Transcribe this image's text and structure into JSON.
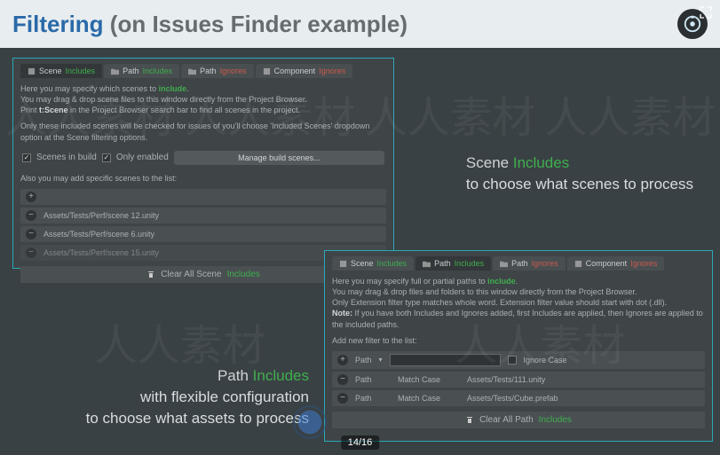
{
  "header": {
    "title_a": "Filtering",
    "title_b": "(on Issues Finder example)"
  },
  "pager": "14/16",
  "captions": {
    "scene_lead": "Scene ",
    "scene_inc": "Includes",
    "scene_sub": "to choose what scenes to process",
    "path_lead": "Path ",
    "path_inc": "Includes",
    "path_sub1": "with flexible configuration",
    "path_sub2": "to choose what assets to process"
  },
  "scene_panel": {
    "tabs": {
      "scene_includes": {
        "pre": "Scene ",
        "suf": "Includes"
      },
      "path_includes": {
        "pre": "Path ",
        "suf": "Includes"
      },
      "path_ignores": {
        "pre": "Path ",
        "suf": "Ignores"
      },
      "component_ignores": {
        "pre": "Component ",
        "suf": "Ignores"
      }
    },
    "hint1": "Here you may specify which scenes to ",
    "hint1_inc": "include",
    "hint1_end": ".",
    "hint2": "You may drag & drop scene files to this window directly from the Project Browser.",
    "hint3_a": "Print ",
    "hint3_b": "t:Scene",
    "hint3_c": " in the Project Browser search bar to find all scenes in the project.",
    "hint4": "Only these included scenes will be checked for issues of you'll choose 'Included Scenes' dropdown option at the Scene filtering options.",
    "opt_builds": "Scenes in build",
    "opt_enabled": "Only enabled",
    "manage_btn": "Manage build scenes...",
    "also_label": "Also you may add specific scenes to the list:",
    "items": [
      "Assets/Tests/Perf/scene 12.unity",
      "Assets/Tests/Perf/scene 6.unity",
      "Assets/Tests/Perf/scene 15.unity"
    ],
    "clear_pre": "Clear All Scene ",
    "clear_suf": "Includes"
  },
  "path_panel": {
    "tabs": {
      "scene_includes": {
        "pre": "Scene ",
        "suf": "Includes"
      },
      "path_includes": {
        "pre": "Path ",
        "suf": "Includes"
      },
      "path_ignores": {
        "pre": "Path ",
        "suf": "Ignores"
      },
      "component_ignores": {
        "pre": "Component ",
        "suf": "Ignores"
      }
    },
    "hint1": "Here you may specify full or partial paths to ",
    "hint1_inc": "include",
    "hint1_end": ".",
    "hint2": "You may drag & drop files and folders to this window directly from the Project Browser.",
    "hint3": "Only Extension filter type matches whole word. Extension filter value should start with dot (.dll).",
    "hint4_a": "Note:",
    "hint4_b": " If you have both Includes and Ignores added, first Includes are applied, then Ignores are applied to the included paths.",
    "add_label": "Add new filter to the list:",
    "head_path": "Path",
    "head_ignorecase": "Ignore Case",
    "rows": [
      {
        "type": "Path",
        "match": "Match Case",
        "val": "Assets/Tests/111.unity"
      },
      {
        "type": "Path",
        "match": "Match Case",
        "val": "Assets/Tests/Cube.prefab"
      }
    ],
    "clear_pre": "Clear All Path ",
    "clear_suf": "Includes"
  }
}
